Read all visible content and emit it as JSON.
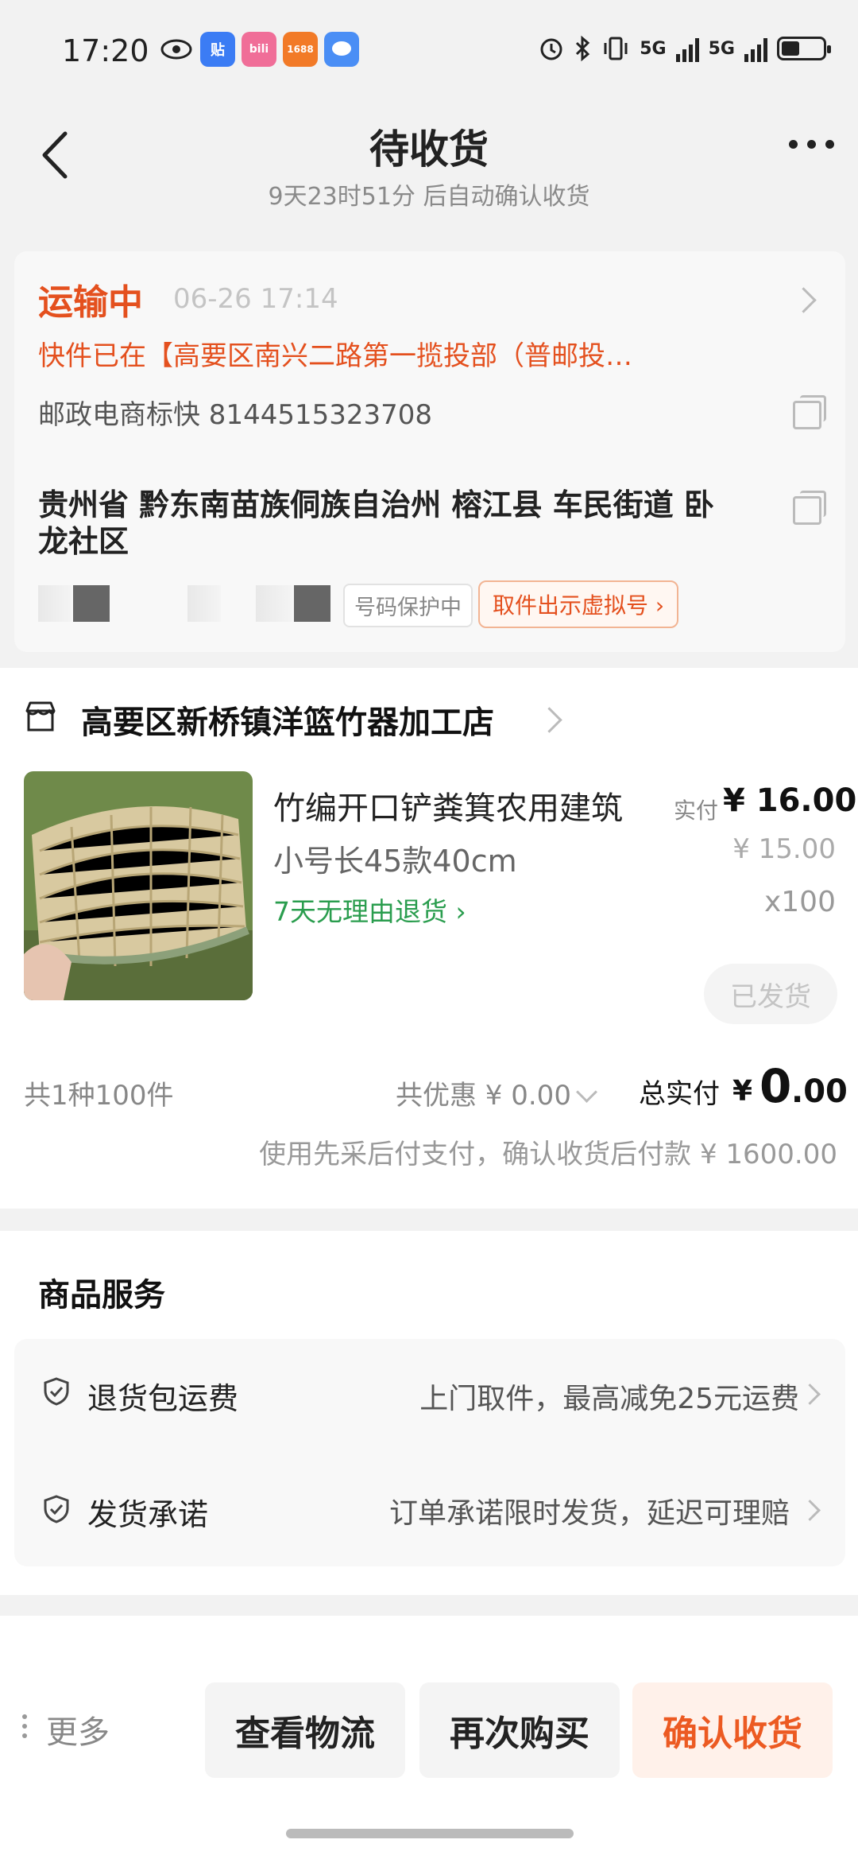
{
  "status_bar": {
    "time": "17:20",
    "network": "5G",
    "apps": [
      {
        "icon": "eye-icon"
      },
      {
        "icon": "tieba-icon",
        "label": "贴",
        "color": "#3b7cf4"
      },
      {
        "icon": "bilibili-icon",
        "label": "bili",
        "color": "#f06e98"
      },
      {
        "icon": "taobao1688-icon",
        "label": "1688",
        "color": "#f27a27"
      },
      {
        "icon": "chat-bubble-icon",
        "color": "#4a8ef5"
      }
    ]
  },
  "header": {
    "title": "待收货",
    "subtitle": "9天23时51分 后自动确认收货"
  },
  "logistics": {
    "status": "运输中",
    "time": "06-26 17:14",
    "message": "快件已在【高要区南兴二路第一揽投部（普邮投…",
    "tracking": "邮政电商标快 8144515323708",
    "address": "贵州省 黔东南苗族侗族自治州 榕江县 车民街道 卧龙社区",
    "privacy_badge": "号码保护中",
    "virtual_number_button": "取件出示虚拟号 ›",
    "accent_color": "#e4501e"
  },
  "shop": {
    "name": "高要区新桥镇洋篮竹器加工店"
  },
  "product": {
    "name": "竹编开口铲粪箕农用建筑",
    "sku": "小号长45款40cm",
    "return_policy": "7天无理由退货 ›",
    "paid_label": "实付",
    "paid_price": "¥ 16.00",
    "original_price": "¥ 15.00",
    "quantity": "x100",
    "status_button": "已发货"
  },
  "summary": {
    "count": "共1种100件",
    "discount": "共优惠 ¥ 0.00",
    "total_label": "总实付",
    "total_currency": "¥",
    "total_int": "0",
    "total_dec": ".00",
    "pay_later": "使用先采后付支付，确认收货后付款 ¥ 1600.00"
  },
  "services": {
    "title": "商品服务",
    "items": [
      {
        "name": "退货包运费",
        "desc": "上门取件，最高减免25元运费"
      },
      {
        "name": "发货承诺",
        "desc": "订单承诺限时发货，延迟可理赔"
      }
    ]
  },
  "bottom": {
    "more": "更多",
    "buttons": [
      "查看物流",
      "再次购买",
      "确认收货"
    ]
  }
}
